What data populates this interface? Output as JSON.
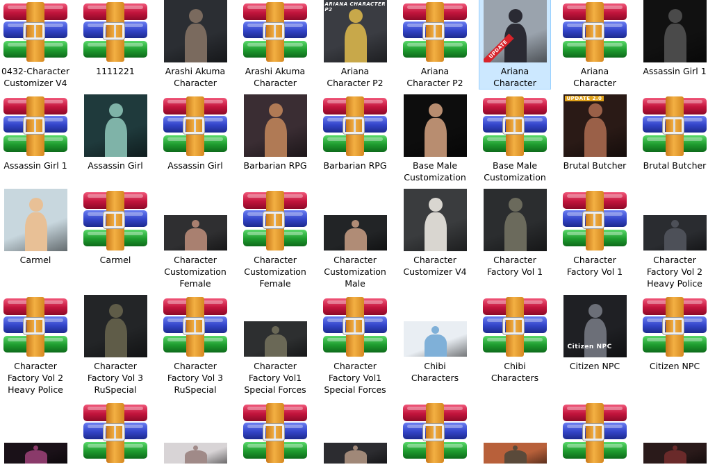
{
  "items": [
    {
      "label": "0432-Character\nCustomizer V4",
      "icon": "rar"
    },
    {
      "label": "1111221",
      "icon": "rar"
    },
    {
      "label": "Arashi Akuma\nCharacter",
      "icon": "photo",
      "shape": "full",
      "bg": "#2b2e33",
      "fg": "#7a6a5e"
    },
    {
      "label": "Arashi Akuma\nCharacter",
      "icon": "rar"
    },
    {
      "label": "Ariana\nCharacter P2",
      "icon": "photo",
      "shape": "full",
      "bg": "#3a3c42",
      "fg": "#c8a84a",
      "badge": "ARIANA CHARACTER P2"
    },
    {
      "label": "Ariana\nCharacter P2",
      "icon": "rar"
    },
    {
      "label": "Ariana\nCharacter",
      "icon": "photo",
      "shape": "full",
      "bg": "#9aa3ad",
      "fg": "#2a2a33",
      "badge": "UPDATE",
      "selected": true
    },
    {
      "label": "Ariana\nCharacter",
      "icon": "rar"
    },
    {
      "label": "Assassin Girl 1",
      "icon": "photo",
      "shape": "full",
      "bg": "#111111",
      "fg": "#4a4a4a"
    },
    {
      "label": "Assassin Girl 1",
      "icon": "rar"
    },
    {
      "label": "Assassin Girl",
      "icon": "photo",
      "shape": "full",
      "bg": "#1f3a3c",
      "fg": "#7fb3a8"
    },
    {
      "label": "Assassin Girl",
      "icon": "rar"
    },
    {
      "label": "Barbarian RPG",
      "icon": "photo",
      "shape": "full",
      "bg": "#3a2d33",
      "fg": "#b07a55"
    },
    {
      "label": "Barbarian RPG",
      "icon": "rar"
    },
    {
      "label": "Base Male\nCustomization",
      "icon": "photo",
      "shape": "full",
      "bg": "#0d0d0d",
      "fg": "#b88d70"
    },
    {
      "label": "Base Male\nCustomization",
      "icon": "rar"
    },
    {
      "label": "Brutal Butcher",
      "icon": "photo",
      "shape": "full",
      "bg": "#2a1a16",
      "fg": "#9a6048",
      "badge": "UPDATE 2.0"
    },
    {
      "label": "Brutal Butcher",
      "icon": "rar"
    },
    {
      "label": "Carmel",
      "icon": "photo",
      "shape": "full",
      "bg": "#c8d7de",
      "fg": "#e8c096"
    },
    {
      "label": "Carmel",
      "icon": "rar"
    },
    {
      "label": "Character\nCustomization\nFemale",
      "icon": "photo",
      "shape": "wide",
      "bg": "#2f2f31",
      "fg": "#a98070"
    },
    {
      "label": "Character\nCustomization\nFemale",
      "icon": "rar"
    },
    {
      "label": "Character\nCustomization\nMale",
      "icon": "photo",
      "shape": "wide",
      "bg": "#222426",
      "fg": "#b08c76"
    },
    {
      "label": "Character\nCustomizer V4",
      "icon": "photo",
      "shape": "full",
      "bg": "#3a3c3e",
      "fg": "#d9d6d0"
    },
    {
      "label": "Character\nFactory Vol 1",
      "icon": "photo",
      "shape": "full",
      "bg": "#2b2d2f",
      "fg": "#6b6a5c"
    },
    {
      "label": "Character\nFactory Vol 1",
      "icon": "rar"
    },
    {
      "label": "Character\nFactory Vol 2\nHeavy Police",
      "icon": "photo",
      "shape": "wide",
      "bg": "#2a2c30",
      "fg": "#4d5058"
    },
    {
      "label": "Character\nFactory Vol 2\nHeavy Police",
      "icon": "rar"
    },
    {
      "label": "Character\nFactory Vol 3\nRuSpecial",
      "icon": "photo",
      "shape": "full",
      "bg": "#232527",
      "fg": "#5f5c48"
    },
    {
      "label": "Character\nFactory Vol 3\nRuSpecial",
      "icon": "rar"
    },
    {
      "label": "Character\nFactory Vol1\nSpecial Forces",
      "icon": "photo",
      "shape": "wide",
      "bg": "#2d2f30",
      "fg": "#6a6856"
    },
    {
      "label": "Character\nFactory Vol1\nSpecial Forces",
      "icon": "rar"
    },
    {
      "label": "Chibi\nCharacters",
      "icon": "photo",
      "shape": "wide",
      "bg": "#e9eef3",
      "fg": "#7fb0d8"
    },
    {
      "label": "Chibi\nCharacters",
      "icon": "rar"
    },
    {
      "label": "Citizen NPC",
      "icon": "photo",
      "shape": "full",
      "bg": "#1f2024",
      "fg": "#6c6f78",
      "badge": "Citizen NPC"
    },
    {
      "label": "Citizen NPC",
      "icon": "rar"
    },
    {
      "label": "",
      "icon": "photo",
      "shape": "clip",
      "bg": "#1a1118",
      "fg": "#8a3a6a"
    },
    {
      "label": "",
      "icon": "rar"
    },
    {
      "label": "",
      "icon": "photo",
      "shape": "clip",
      "bg": "#d8d4d6",
      "fg": "#a08a88"
    },
    {
      "label": "",
      "icon": "rar"
    },
    {
      "label": "",
      "icon": "photo",
      "shape": "clip",
      "bg": "#2c2c30",
      "fg": "#a08878"
    },
    {
      "label": "",
      "icon": "rar"
    },
    {
      "label": "",
      "icon": "photo",
      "shape": "clip",
      "bg": "#b8603a",
      "fg": "#5a4a3a"
    },
    {
      "label": "",
      "icon": "rar"
    },
    {
      "label": "",
      "icon": "photo",
      "shape": "clip",
      "bg": "#2a1a1a",
      "fg": "#6a2a2a"
    }
  ]
}
